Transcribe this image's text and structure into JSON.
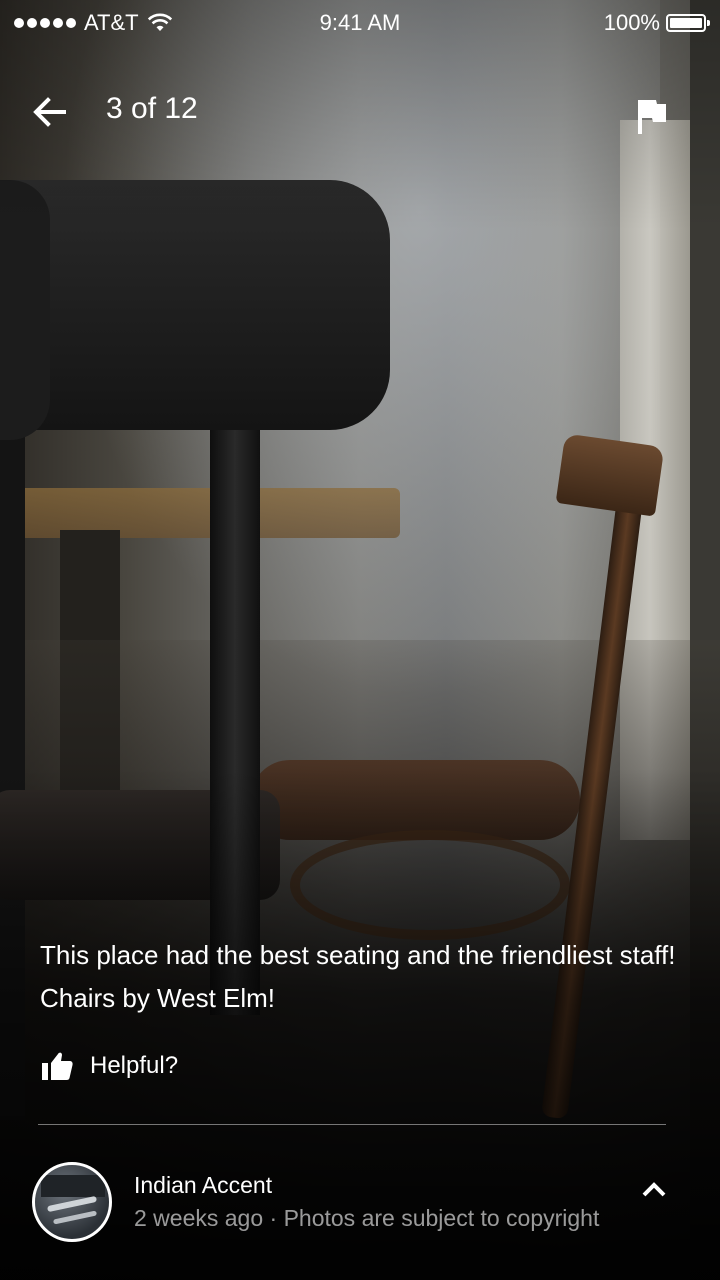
{
  "status_bar": {
    "carrier": "AT&T",
    "time": "9:41 AM",
    "battery": "100%"
  },
  "header": {
    "counter": "3 of 12",
    "back_icon": "arrow-left-icon",
    "flag_icon": "flag-icon"
  },
  "review": {
    "caption": "This place had the best seating and the friendliest staff! Chairs by West Elm!",
    "helpful_label": "Helpful?",
    "helpful_icon": "thumbs-up-icon"
  },
  "footer": {
    "author": "Indian Accent",
    "meta": "2 weeks ago · Photos are subject to copyright",
    "expand_icon": "chevron-up-icon"
  }
}
